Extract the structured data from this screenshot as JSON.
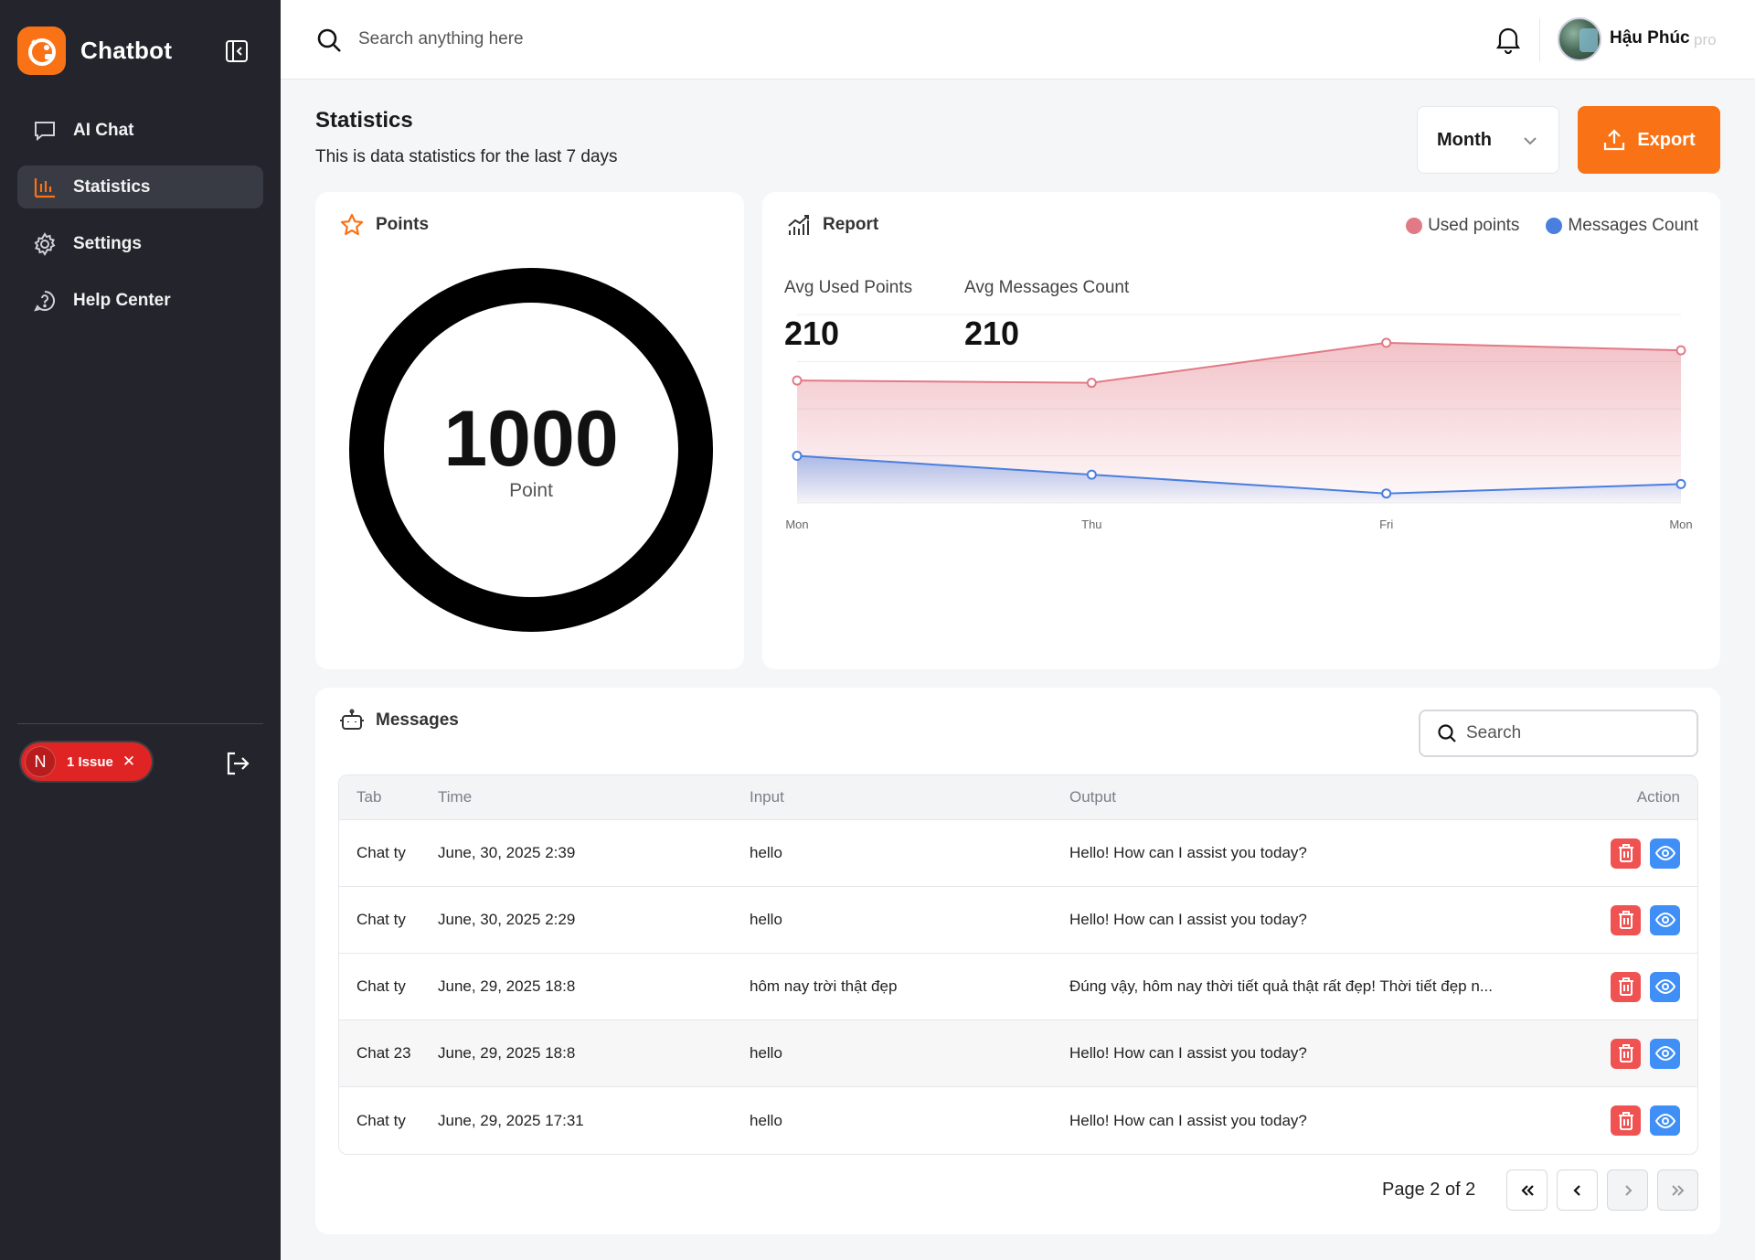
{
  "app": {
    "name": "Chatbot"
  },
  "sidebar": {
    "items": [
      {
        "label": "AI Chat",
        "icon": "chat-bubble-icon",
        "active": false
      },
      {
        "label": "Statistics",
        "icon": "bar-chart-icon",
        "active": true
      },
      {
        "label": "Settings",
        "icon": "gear-icon",
        "active": false
      },
      {
        "label": "Help Center",
        "icon": "help-circle-icon",
        "active": false
      }
    ],
    "issue": {
      "letter": "N",
      "label": "1 Issue"
    }
  },
  "header": {
    "search_placeholder": "Search anything here",
    "user_name": "Hậu Phúc",
    "user_plan": "pro"
  },
  "page": {
    "title": "Statistics",
    "subtitle": "This is data statistics for the last 7 days",
    "period": "Month",
    "export_label": "Export"
  },
  "points": {
    "title": "Points",
    "value": "1000",
    "unit": "Point"
  },
  "report": {
    "title": "Report",
    "legend": [
      {
        "label": "Used points",
        "color": "#e27a86"
      },
      {
        "label": "Messages Count",
        "color": "#4a7fe0"
      }
    ],
    "avg_used_label": "Avg Used Points",
    "avg_used_value": "210",
    "avg_msgs_label": "Avg Messages Count",
    "avg_msgs_value": "210"
  },
  "chart_data": {
    "type": "area",
    "categories": [
      "Mon",
      "Thu",
      "Fri",
      "Mon"
    ],
    "series": [
      {
        "name": "Used points",
        "values": [
          260,
          255,
          340,
          324
        ],
        "color": "#e27a86"
      },
      {
        "name": "Messages Count",
        "values": [
          100,
          60,
          20,
          40
        ],
        "color": "#4a7fe0"
      }
    ],
    "ylim": [
      0,
      400
    ],
    "grid": true
  },
  "messages": {
    "title": "Messages",
    "search_placeholder": "Search",
    "columns": {
      "tab": "Tab",
      "time": "Time",
      "input": "Input",
      "output": "Output",
      "action": "Action"
    },
    "rows": [
      {
        "tab": "Chat ty",
        "time": "June, 30, 2025 2:39",
        "input": "hello",
        "output": "Hello! How can I assist you today?"
      },
      {
        "tab": "Chat ty",
        "time": "June, 30, 2025 2:29",
        "input": "hello",
        "output": "Hello! How can I assist you today?"
      },
      {
        "tab": "Chat ty",
        "time": "June, 29, 2025 18:8",
        "input": "hôm nay trời thật đẹp",
        "output": "Đúng vậy, hôm nay thời tiết quả thật rất đẹp! Thời tiết đẹp n..."
      },
      {
        "tab": "Chat 23",
        "time": "June, 29, 2025 18:8",
        "input": "hello",
        "output": "Hello! How can I assist you today?"
      },
      {
        "tab": "Chat ty",
        "time": "June, 29, 2025 17:31",
        "input": "hello",
        "output": "Hello! How can I assist you today?"
      }
    ],
    "pagination": "Page 2 of 2"
  },
  "colors": {
    "accent": "#f97316",
    "sidebar": "#24252c",
    "danger": "#f05252",
    "info": "#3f8ff7"
  }
}
